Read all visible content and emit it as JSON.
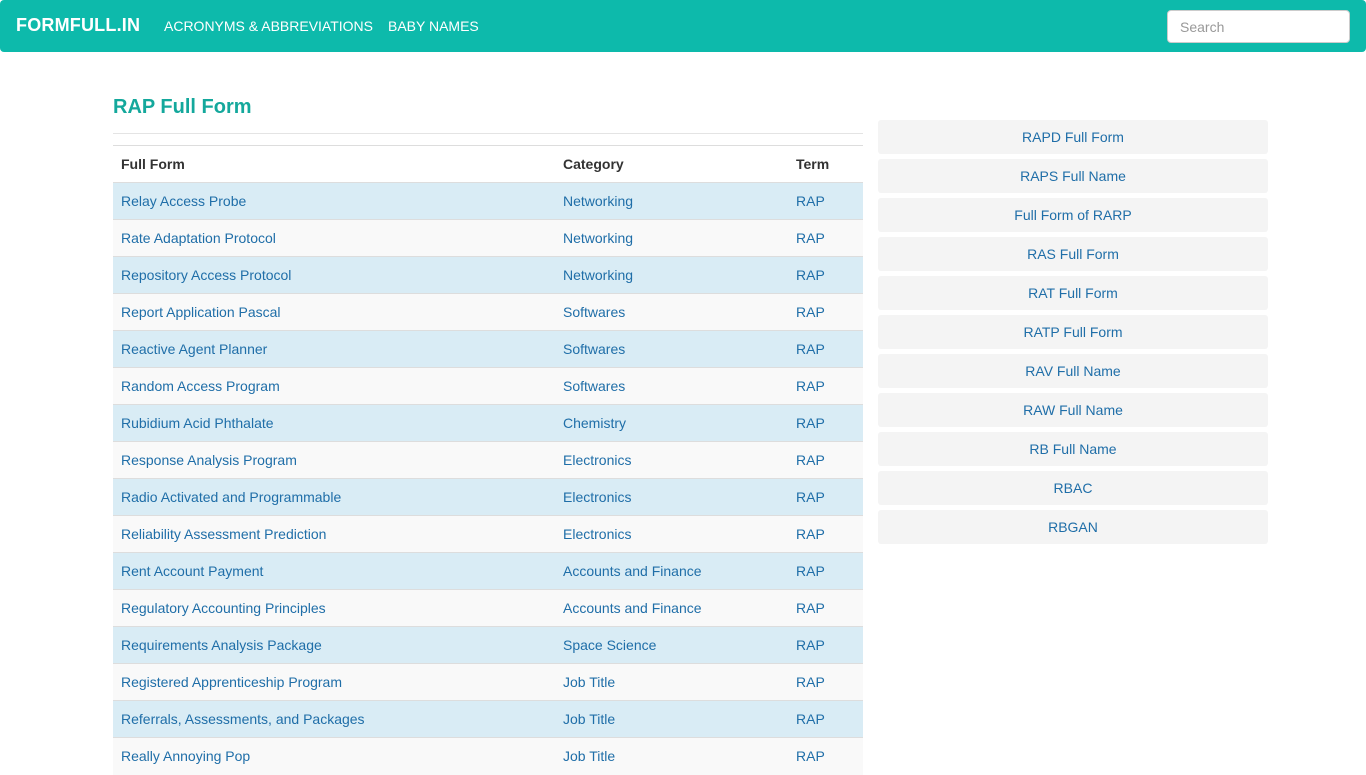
{
  "nav": {
    "brand": "FORMFULL.IN",
    "links": [
      "ACRONYMS & ABBREVIATIONS",
      "BABY NAMES"
    ],
    "search_placeholder": "Search"
  },
  "main": {
    "title": "RAP Full Form",
    "table": {
      "headers": [
        "Full Form",
        "Category",
        "Term"
      ],
      "rows": [
        [
          "Relay Access Probe",
          "Networking",
          "RAP"
        ],
        [
          "Rate Adaptation Protocol",
          "Networking",
          "RAP"
        ],
        [
          "Repository Access Protocol",
          "Networking",
          "RAP"
        ],
        [
          "Report Application Pascal",
          "Softwares",
          "RAP"
        ],
        [
          "Reactive Agent Planner",
          "Softwares",
          "RAP"
        ],
        [
          "Random Access Program",
          "Softwares",
          "RAP"
        ],
        [
          "Rubidium Acid Phthalate",
          "Chemistry",
          "RAP"
        ],
        [
          "Response Analysis Program",
          "Electronics",
          "RAP"
        ],
        [
          "Radio Activated and Programmable",
          "Electronics",
          "RAP"
        ],
        [
          "Reliability Assessment Prediction",
          "Electronics",
          "RAP"
        ],
        [
          "Rent Account Payment",
          "Accounts and Finance",
          "RAP"
        ],
        [
          "Regulatory Accounting Principles",
          "Accounts and Finance",
          "RAP"
        ],
        [
          "Requirements Analysis Package",
          "Space Science",
          "RAP"
        ],
        [
          "Registered Apprenticeship Program",
          "Job Title",
          "RAP"
        ],
        [
          "Referrals, Assessments, and Packages",
          "Job Title",
          "RAP"
        ],
        [
          "Really Annoying Pop",
          "Job Title",
          "RAP"
        ]
      ]
    }
  },
  "sidebar": {
    "items": [
      "RAPD Full Form",
      "RAPS Full Name",
      "Full Form of RARP",
      "RAS Full Form",
      "RAT Full Form",
      "RATP Full Form",
      "RAV Full Name",
      "RAW Full Name",
      "RB Full Name",
      "RBAC",
      "RBGAN"
    ]
  },
  "colors": {
    "navbar": "#0dbaab",
    "title": "#14a89c",
    "link": "#1f6ea8",
    "row_odd": "#d9ecf5",
    "row_even": "#f9f9f9"
  }
}
